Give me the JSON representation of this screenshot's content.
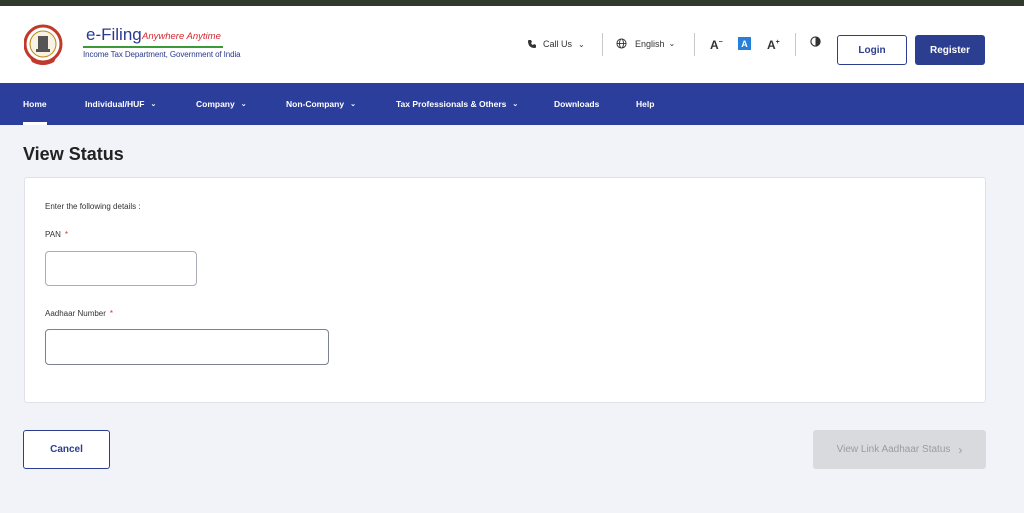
{
  "header": {
    "brand_name": "e-Filing",
    "brand_tagline": "Anywhere Anytime",
    "brand_sub": "Income Tax Department, Government of India",
    "call_us": "Call Us",
    "language": "English",
    "font_decrease": "A",
    "font_default": "A",
    "font_increase": "A",
    "login": "Login",
    "register": "Register"
  },
  "nav": {
    "items": [
      {
        "label": "Home"
      },
      {
        "label": "Individual/HUF"
      },
      {
        "label": "Company"
      },
      {
        "label": "Non-Company"
      },
      {
        "label": "Tax Professionals & Others"
      },
      {
        "label": "Downloads"
      },
      {
        "label": "Help"
      }
    ]
  },
  "page": {
    "title": "View Status",
    "instruction": "Enter the following details :",
    "pan_label": "PAN",
    "pan_value": "",
    "aadhaar_label": "Aadhaar Number",
    "aadhaar_value": "",
    "required_mark": "*",
    "cancel": "Cancel",
    "view_status": "View Link Aadhaar Status"
  },
  "colors": {
    "primary": "#2c3e9c",
    "required": "#d32f2f",
    "disabled_bg": "#d9dadd"
  }
}
